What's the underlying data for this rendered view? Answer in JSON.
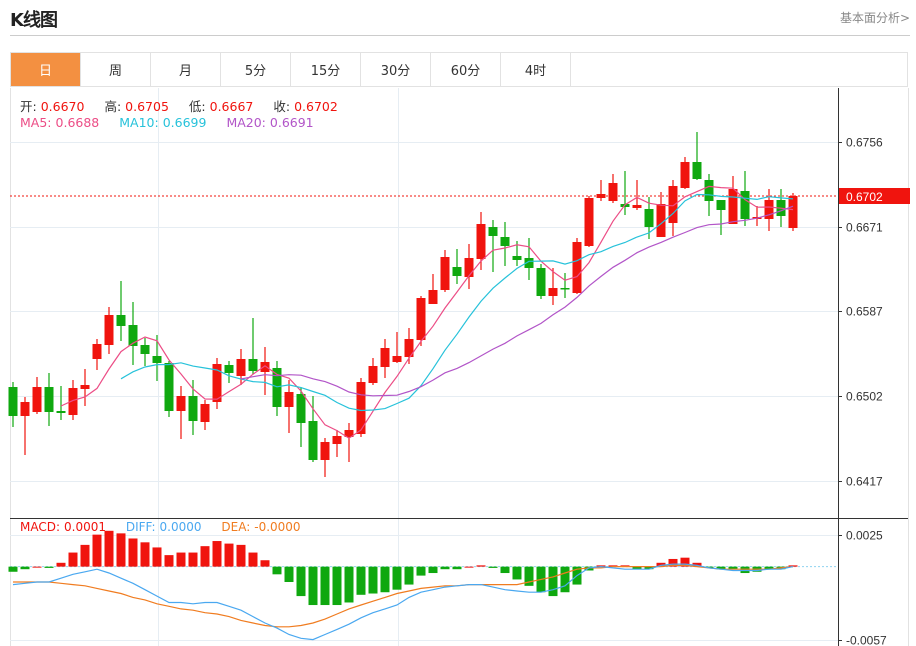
{
  "header": {
    "title": "K线图",
    "link": "基本面分析>"
  },
  "tabs": [
    {
      "label": "日",
      "active": true
    },
    {
      "label": "周"
    },
    {
      "label": "月"
    },
    {
      "label": "5分"
    },
    {
      "label": "15分"
    },
    {
      "label": "30分"
    },
    {
      "label": "60分"
    },
    {
      "label": "4时"
    }
  ],
  "info": {
    "open_label": "开:",
    "open": "0.6670",
    "high_label": "高:",
    "high": "0.6705",
    "low_label": "低:",
    "low": "0.6667",
    "close_label": "收:",
    "close": "0.6702",
    "ma5_label": "MA5:",
    "ma5": "0.6688",
    "ma10_label": "MA10:",
    "ma10": "0.6699",
    "ma20_label": "MA20:",
    "ma20": "0.6691"
  },
  "macd_info": {
    "macd_label": "MACD:",
    "macd": "0.0001",
    "diff_label": "DIFF:",
    "diff": "0.0000",
    "dea_label": "DEA:",
    "dea": "-0.0000"
  },
  "colors": {
    "up": "#f0140e",
    "down": "#0fa80f",
    "ma5": "#ec4d86",
    "ma10": "#27c2da",
    "ma20": "#b255c8",
    "diff": "#4aa8f0",
    "dea": "#f07c20",
    "tab_active": "#f39041"
  },
  "chart_data": {
    "type": "candlestick",
    "y_ticks": [
      "0.6756",
      "0.6671",
      "0.6587",
      "0.6502",
      "0.6417"
    ],
    "ylim": [
      0.638,
      0.681
    ],
    "current_price": "0.6702",
    "ohlc": [
      [
        0.6511,
        0.6516,
        0.6471,
        0.6482
      ],
      [
        0.6482,
        0.6501,
        0.6443,
        0.6496
      ],
      [
        0.6486,
        0.6521,
        0.6484,
        0.6511
      ],
      [
        0.6511,
        0.6525,
        0.6472,
        0.6486
      ],
      [
        0.6487,
        0.6512,
        0.6478,
        0.6485
      ],
      [
        0.6483,
        0.6518,
        0.6478,
        0.651
      ],
      [
        0.6509,
        0.6529,
        0.6492,
        0.6513
      ],
      [
        0.6539,
        0.6559,
        0.6528,
        0.6554
      ],
      [
        0.6553,
        0.6591,
        0.6544,
        0.6583
      ],
      [
        0.6583,
        0.6617,
        0.6557,
        0.6572
      ],
      [
        0.6573,
        0.6596,
        0.6533,
        0.6552
      ],
      [
        0.6553,
        0.656,
        0.6532,
        0.6544
      ],
      [
        0.6542,
        0.6563,
        0.6517,
        0.6535
      ],
      [
        0.6535,
        0.6537,
        0.6481,
        0.6487
      ],
      [
        0.6487,
        0.6512,
        0.6459,
        0.6502
      ],
      [
        0.6502,
        0.6518,
        0.6463,
        0.6477
      ],
      [
        0.6476,
        0.6498,
        0.6468,
        0.6494
      ],
      [
        0.6496,
        0.654,
        0.6489,
        0.6534
      ],
      [
        0.6533,
        0.6537,
        0.6515,
        0.6525
      ],
      [
        0.6522,
        0.6549,
        0.6513,
        0.6539
      ],
      [
        0.6539,
        0.658,
        0.6524,
        0.6527
      ],
      [
        0.6526,
        0.6551,
        0.6503,
        0.6536
      ],
      [
        0.653,
        0.6537,
        0.6482,
        0.6491
      ],
      [
        0.6491,
        0.6518,
        0.6465,
        0.6506
      ],
      [
        0.6504,
        0.6511,
        0.6451,
        0.6475
      ],
      [
        0.6477,
        0.6502,
        0.6436,
        0.6438
      ],
      [
        0.6438,
        0.646,
        0.6421,
        0.6456
      ],
      [
        0.6454,
        0.6468,
        0.6441,
        0.6462
      ],
      [
        0.6461,
        0.6475,
        0.6436,
        0.6468
      ],
      [
        0.6464,
        0.652,
        0.6461,
        0.6516
      ],
      [
        0.6515,
        0.654,
        0.6513,
        0.6532
      ],
      [
        0.6531,
        0.6559,
        0.652,
        0.655
      ],
      [
        0.6536,
        0.6566,
        0.6535,
        0.6542
      ],
      [
        0.6541,
        0.657,
        0.6534,
        0.6559
      ],
      [
        0.6558,
        0.6602,
        0.6552,
        0.66
      ],
      [
        0.6594,
        0.6624,
        0.6594,
        0.6608
      ],
      [
        0.6608,
        0.6648,
        0.6606,
        0.6641
      ],
      [
        0.6631,
        0.6649,
        0.6614,
        0.6622
      ],
      [
        0.6621,
        0.6654,
        0.6609,
        0.664
      ],
      [
        0.6639,
        0.6686,
        0.6628,
        0.6674
      ],
      [
        0.6671,
        0.6678,
        0.6626,
        0.6662
      ],
      [
        0.6661,
        0.6676,
        0.6632,
        0.6652
      ],
      [
        0.6642,
        0.6657,
        0.6632,
        0.6638
      ],
      [
        0.664,
        0.666,
        0.6618,
        0.663
      ],
      [
        0.663,
        0.6634,
        0.6599,
        0.6602
      ],
      [
        0.6602,
        0.663,
        0.6593,
        0.661
      ],
      [
        0.661,
        0.6625,
        0.66,
        0.6609
      ],
      [
        0.6605,
        0.666,
        0.6604,
        0.6656
      ],
      [
        0.6652,
        0.6702,
        0.6651,
        0.67
      ],
      [
        0.67,
        0.6718,
        0.6697,
        0.6704
      ],
      [
        0.6697,
        0.6724,
        0.6695,
        0.6715
      ],
      [
        0.6694,
        0.6727,
        0.6683,
        0.6691
      ],
      [
        0.669,
        0.6718,
        0.6688,
        0.6693
      ],
      [
        0.6689,
        0.6701,
        0.6659,
        0.6671
      ],
      [
        0.6661,
        0.6706,
        0.6661,
        0.6694
      ],
      [
        0.6675,
        0.6718,
        0.6662,
        0.6712
      ],
      [
        0.671,
        0.6741,
        0.6709,
        0.6736
      ],
      [
        0.6736,
        0.6766,
        0.6718,
        0.6719
      ],
      [
        0.6718,
        0.6724,
        0.6682,
        0.6697
      ],
      [
        0.6698,
        0.6698,
        0.6663,
        0.6688
      ],
      [
        0.6674,
        0.6722,
        0.6674,
        0.6709
      ],
      [
        0.6707,
        0.6727,
        0.6672,
        0.6679
      ],
      [
        0.6679,
        0.6692,
        0.6672,
        0.6681
      ],
      [
        0.6679,
        0.6709,
        0.6667,
        0.6698
      ],
      [
        0.6698,
        0.6709,
        0.6671,
        0.6682
      ],
      [
        0.667,
        0.6705,
        0.6667,
        0.6702
      ]
    ],
    "ma_periods": [
      5,
      10,
      20
    ],
    "macd": {
      "y_ticks": [
        "0.0025",
        "-0.0057"
      ],
      "ylim": [
        -0.0062,
        0.0038
      ],
      "hist": [
        -0.0004,
        -0.0002,
        -0.0,
        -0.0001,
        0.0003,
        0.0011,
        0.0017,
        0.0025,
        0.0028,
        0.0026,
        0.0022,
        0.0019,
        0.0015,
        0.0009,
        0.0011,
        0.0011,
        0.0016,
        0.002,
        0.0018,
        0.0017,
        0.0011,
        0.0005,
        -0.0006,
        -0.0012,
        -0.0023,
        -0.003,
        -0.003,
        -0.003,
        -0.0028,
        -0.0022,
        -0.0021,
        -0.002,
        -0.0018,
        -0.0014,
        -0.0007,
        -0.0005,
        -0.0002,
        -0.0002,
        -0.0,
        0.0001,
        -0.0001,
        -0.0005,
        -0.001,
        -0.0015,
        -0.002,
        -0.0023,
        -0.002,
        -0.0014,
        -0.0003,
        0.0001,
        0.0001,
        0.0001,
        -0.0002,
        -0.0002,
        0.0003,
        0.0006,
        0.0007,
        0.0003,
        -0.0001,
        -0.0002,
        -0.0002,
        -0.0005,
        -0.0004,
        -0.0002,
        -0.0002,
        0.0001
      ],
      "diff": [
        -0.0014,
        -0.0013,
        -0.0012,
        -0.0012,
        -0.0009,
        -0.0006,
        -0.0004,
        -0.0002,
        -0.0005,
        -0.0009,
        -0.0013,
        -0.0018,
        -0.0023,
        -0.0028,
        -0.0028,
        -0.0029,
        -0.0028,
        -0.0028,
        -0.0031,
        -0.0034,
        -0.0039,
        -0.0044,
        -0.0048,
        -0.0053,
        -0.0056,
        -0.0057,
        -0.0053,
        -0.0049,
        -0.0045,
        -0.004,
        -0.0036,
        -0.0033,
        -0.003,
        -0.0024,
        -0.002,
        -0.0018,
        -0.0016,
        -0.0015,
        -0.0014,
        -0.0014,
        -0.0016,
        -0.0018,
        -0.0019,
        -0.002,
        -0.002,
        -0.0018,
        -0.0015,
        -0.0007,
        -0.0001,
        0.0,
        -0.0001,
        -0.0002,
        -0.0002,
        -0.0002,
        0.0001,
        0.0002,
        0.0002,
        0.0001,
        -0.0001,
        -0.0002,
        -0.0003,
        -0.0003,
        -0.0003,
        -0.0002,
        -0.0002,
        0.0
      ],
      "dea": [
        -0.0012,
        -0.0012,
        -0.0012,
        -0.0012,
        -0.0013,
        -0.0014,
        -0.0015,
        -0.0017,
        -0.0019,
        -0.0021,
        -0.0024,
        -0.0026,
        -0.0029,
        -0.0031,
        -0.0033,
        -0.0034,
        -0.0036,
        -0.0037,
        -0.0039,
        -0.0042,
        -0.0044,
        -0.0046,
        -0.0047,
        -0.0047,
        -0.0046,
        -0.0044,
        -0.0041,
        -0.0037,
        -0.0033,
        -0.003,
        -0.0027,
        -0.0024,
        -0.0021,
        -0.0019,
        -0.0017,
        -0.0016,
        -0.0015,
        -0.0015,
        -0.0014,
        -0.0014,
        -0.0014,
        -0.0014,
        -0.0014,
        -0.0012,
        -0.001,
        -0.0008,
        -0.0005,
        -0.0002,
        -0.0001,
        -0.0001,
        0.0,
        0.0,
        0.0,
        0.0,
        0.0,
        0.0001,
        0.0001,
        0.0,
        -0.0001,
        -0.0002,
        -0.0002,
        -0.0002,
        -0.0002,
        -0.0002,
        -0.0001,
        -0.0
      ]
    }
  }
}
